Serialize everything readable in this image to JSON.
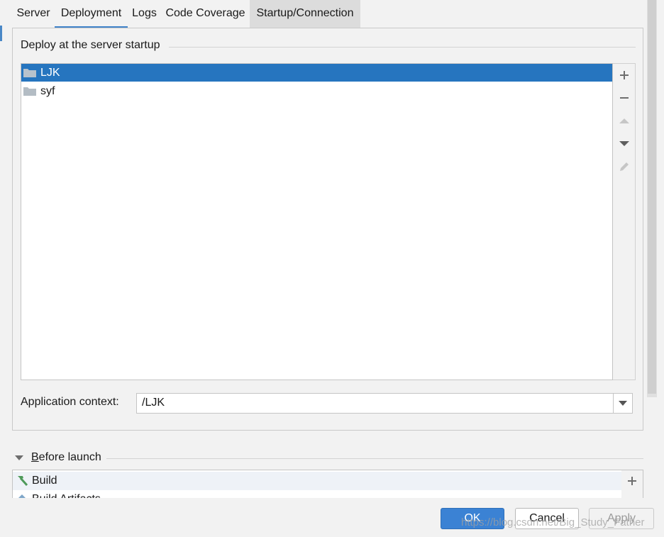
{
  "tabs": [
    {
      "label": "Server"
    },
    {
      "label": "Deployment"
    },
    {
      "label": "Logs"
    },
    {
      "label": "Code Coverage"
    },
    {
      "label": "Startup/Connection"
    }
  ],
  "active_tab": "Deployment",
  "deploy": {
    "group_title": "Deploy at the server startup",
    "items": [
      {
        "label": "LJK",
        "icon": "folder-icon",
        "selected": true
      },
      {
        "label": "syf",
        "icon": "folder-icon",
        "selected": false
      }
    ],
    "toolbar": [
      {
        "name": "add-icon",
        "glyph": "+"
      },
      {
        "name": "remove-icon",
        "glyph": "−"
      },
      {
        "name": "move-up-icon",
        "glyph": "▲"
      },
      {
        "name": "move-down-icon",
        "glyph": "▼"
      },
      {
        "name": "edit-icon",
        "glyph": "✎"
      }
    ]
  },
  "app_context": {
    "label": "Application context:",
    "value": "/LJK"
  },
  "before_launch": {
    "title_mnemonic": "B",
    "title_rest": "efore launch",
    "items": [
      {
        "label": "Build",
        "icon": "hammer-icon"
      },
      {
        "label": "Build Artifacts",
        "icon": "artifact-icon"
      }
    ],
    "add_glyph": "+"
  },
  "buttons": {
    "ok": "OK",
    "cancel": "Cancel",
    "apply": "Apply"
  },
  "watermark": "https://blog.csdn.net/Big_Study_Father",
  "colors": {
    "accent": "#2675bf",
    "tab_underline": "#4083c9",
    "ok_button": "#3b82d4"
  }
}
